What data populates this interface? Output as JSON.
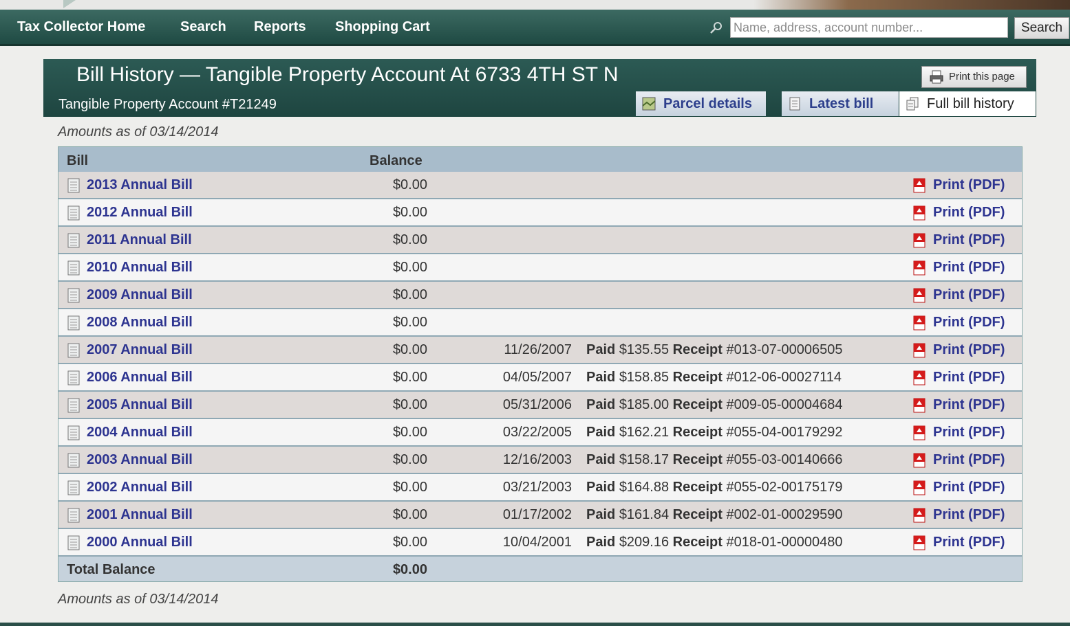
{
  "nav": {
    "items": [
      "Tax Collector Home",
      "Search",
      "Reports",
      "Shopping Cart"
    ],
    "search_placeholder": "Name, address, account number...",
    "search_button": "Search"
  },
  "header": {
    "title": "Bill History — Tangible Property Account At 6733 4TH ST N",
    "subtitle": "Tangible Property Account #T21249",
    "print_label": "Print this page",
    "tabs": [
      {
        "label": "Parcel details",
        "active": false
      },
      {
        "label": "Latest bill",
        "active": false
      },
      {
        "label": "Full bill history",
        "active": true
      }
    ]
  },
  "as_of": "Amounts as of 03/14/2014",
  "table": {
    "headers": {
      "bill": "Bill",
      "balance": "Balance"
    },
    "print_label": "Print (PDF)",
    "rows": [
      {
        "bill": "2013 Annual Bill",
        "balance": "$0.00",
        "date": "",
        "amount": "",
        "receipt_no": ""
      },
      {
        "bill": "2012 Annual Bill",
        "balance": "$0.00",
        "date": "",
        "amount": "",
        "receipt_no": ""
      },
      {
        "bill": "2011 Annual Bill",
        "balance": "$0.00",
        "date": "",
        "amount": "",
        "receipt_no": ""
      },
      {
        "bill": "2010 Annual Bill",
        "balance": "$0.00",
        "date": "",
        "amount": "",
        "receipt_no": ""
      },
      {
        "bill": "2009 Annual Bill",
        "balance": "$0.00",
        "date": "",
        "amount": "",
        "receipt_no": ""
      },
      {
        "bill": "2008 Annual Bill",
        "balance": "$0.00",
        "date": "",
        "amount": "",
        "receipt_no": ""
      },
      {
        "bill": "2007 Annual Bill",
        "balance": "$0.00",
        "date": "11/26/2007",
        "amount": "$135.55",
        "receipt_no": "#013-07-00006505"
      },
      {
        "bill": "2006 Annual Bill",
        "balance": "$0.00",
        "date": "04/05/2007",
        "amount": "$158.85",
        "receipt_no": "#012-06-00027114"
      },
      {
        "bill": "2005 Annual Bill",
        "balance": "$0.00",
        "date": "05/31/2006",
        "amount": "$185.00",
        "receipt_no": "#009-05-00004684"
      },
      {
        "bill": "2004 Annual Bill",
        "balance": "$0.00",
        "date": "03/22/2005",
        "amount": "$162.21",
        "receipt_no": "#055-04-00179292"
      },
      {
        "bill": "2003 Annual Bill",
        "balance": "$0.00",
        "date": "12/16/2003",
        "amount": "$158.17",
        "receipt_no": "#055-03-00140666"
      },
      {
        "bill": "2002 Annual Bill",
        "balance": "$0.00",
        "date": "03/21/2003",
        "amount": "$164.88",
        "receipt_no": "#055-02-00175179"
      },
      {
        "bill": "2001 Annual Bill",
        "balance": "$0.00",
        "date": "01/17/2002",
        "amount": "$161.84",
        "receipt_no": "#002-01-00029590"
      },
      {
        "bill": "2000 Annual Bill",
        "balance": "$0.00",
        "date": "10/04/2001",
        "amount": "$209.16",
        "receipt_no": "#018-01-00000480"
      }
    ],
    "paid_word": "Paid",
    "receipt_word": "Receipt",
    "total_label": "Total Balance",
    "total_value": "$0.00"
  },
  "colors": {
    "nav_bg": "#25524b",
    "link": "#2d3490",
    "header_row": "#a8bccb",
    "row_odd": "#dfdad8",
    "row_even": "#f5f5f5"
  }
}
